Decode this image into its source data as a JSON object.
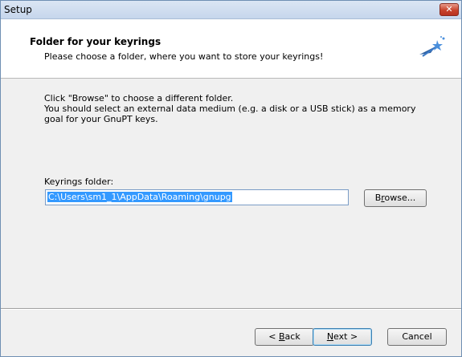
{
  "window": {
    "title": "Setup",
    "close_glyph": "✕"
  },
  "header": {
    "title": "Folder for your keyrings",
    "subtitle": "Please choose a folder, where you want to store your keyrings!",
    "icon": "wizard-star-icon"
  },
  "content": {
    "description_lines": [
      "Click \"Browse\" to choose a different folder.",
      "You should select an external data medium (e.g. a disk or a USB stick) as a memory",
      "goal for your GnuPT keys."
    ],
    "keyrings_label": "Keyrings folder:",
    "keyrings_value": "C:\\Users\\sm1_1\\AppData\\Roaming\\gnupg",
    "browse_label_pre": "B",
    "browse_label_u": "r",
    "browse_label_post": "owse..."
  },
  "footer": {
    "back_pre": "< ",
    "back_u": "B",
    "back_post": "ack",
    "next_u": "N",
    "next_post": "ext >",
    "cancel_label": "Cancel"
  },
  "colors": {
    "selection": "#3399ff",
    "close_button": "#c8432c",
    "title_bar": "#c6d6ec"
  }
}
